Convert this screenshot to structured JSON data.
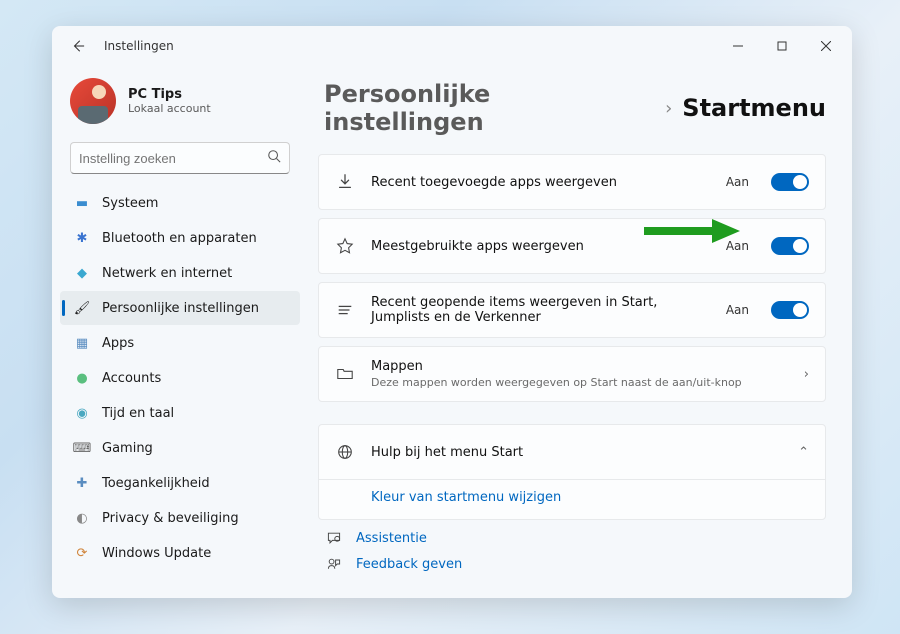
{
  "titlebar": {
    "title": "Instellingen"
  },
  "account": {
    "name": "PC Tips",
    "sub": "Lokaal account"
  },
  "search": {
    "placeholder": "Instelling zoeken"
  },
  "nav": {
    "systeem": "Systeem",
    "bluetooth": "Bluetooth en apparaten",
    "netwerk": "Netwerk en internet",
    "persoonlijk": "Persoonlijke instellingen",
    "apps": "Apps",
    "accounts": "Accounts",
    "tijd": "Tijd en taal",
    "gaming": "Gaming",
    "toegankelijkheid": "Toegankelijkheid",
    "privacy": "Privacy & beveiliging",
    "update": "Windows Update"
  },
  "breadcrumb": {
    "seg1": "Persoonlijke instellingen",
    "seg2": "Startmenu"
  },
  "settings": {
    "recent_apps": {
      "label": "Recent toegevoegde apps weergeven",
      "state": "Aan"
    },
    "most_used": {
      "label": "Meestgebruikte apps weergeven",
      "state": "Aan"
    },
    "recent_items": {
      "label": "Recent geopende items weergeven in Start, Jumplists en de Verkenner",
      "state": "Aan"
    },
    "folders": {
      "label": "Mappen",
      "sub": "Deze mappen worden weergegeven op Start naast de aan/uit-knop"
    }
  },
  "help": {
    "title": "Hulp bij het menu Start",
    "link": "Kleur van startmenu wijzigen"
  },
  "footer": {
    "assist": "Assistentie",
    "feedback": "Feedback geven"
  }
}
